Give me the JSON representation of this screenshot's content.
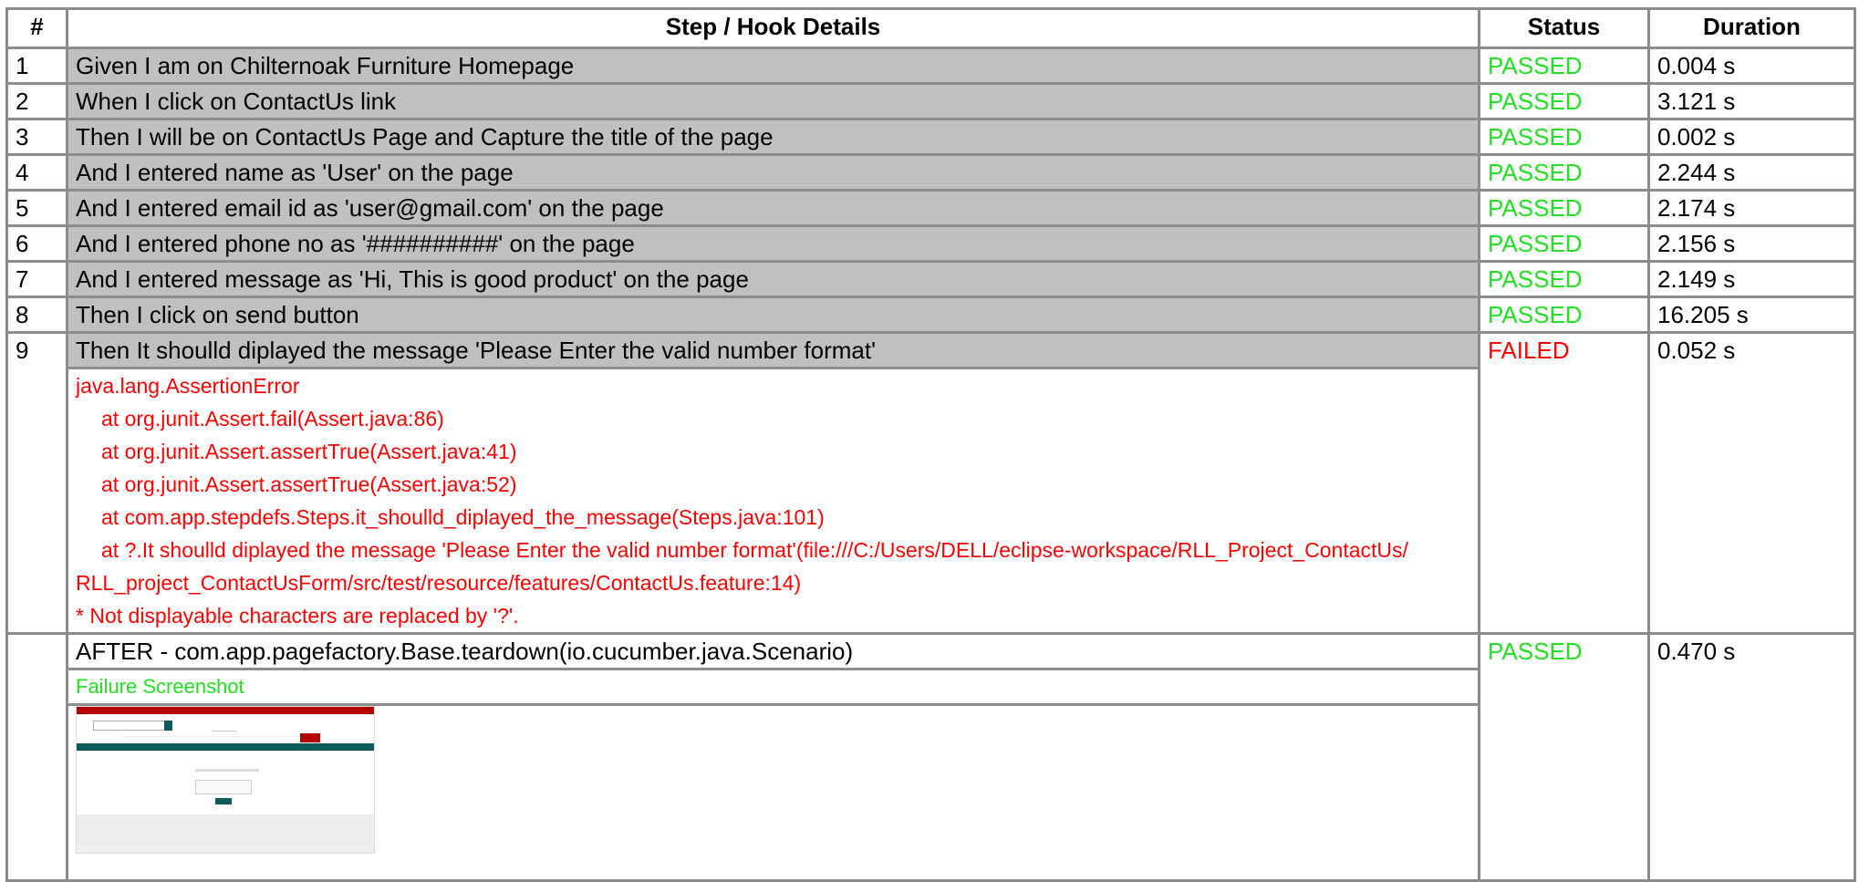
{
  "header": {
    "num": "#",
    "details": "Step / Hook Details",
    "status": "Status",
    "duration": "Duration"
  },
  "steps": [
    {
      "num": "1",
      "text": "Given I am on Chilternoak Furniture Homepage",
      "status": "PASSED",
      "duration": "0.004 s"
    },
    {
      "num": "2",
      "text": "When I click on ContactUs link",
      "status": "PASSED",
      "duration": "3.121 s"
    },
    {
      "num": "3",
      "text": "Then I will be on ContactUs Page and Capture the title of the page",
      "status": "PASSED",
      "duration": "0.002 s"
    },
    {
      "num": "4",
      "text": "And I entered name as 'User' on the page",
      "status": "PASSED",
      "duration": "2.244 s"
    },
    {
      "num": "5",
      "text": "And I entered email id as 'user@gmail.com' on the page",
      "status": "PASSED",
      "duration": "2.174 s"
    },
    {
      "num": "6",
      "text": "And I entered phone no as '##########' on the page",
      "status": "PASSED",
      "duration": "2.156 s"
    },
    {
      "num": "7",
      "text": "And I entered message as 'Hi, This is good product' on the page",
      "status": "PASSED",
      "duration": "2.149 s"
    },
    {
      "num": "8",
      "text": "Then I click on send button",
      "status": "PASSED",
      "duration": "16.205 s"
    },
    {
      "num": "9",
      "text": "Then It shoulld diplayed the message 'Please Enter the valid number format'",
      "status": "FAILED",
      "duration": "0.052 s"
    }
  ],
  "error": {
    "lines": [
      "java.lang.AssertionError",
      "at org.junit.Assert.fail(Assert.java:86)",
      "at org.junit.Assert.assertTrue(Assert.java:41)",
      "at org.junit.Assert.assertTrue(Assert.java:52)",
      "at com.app.stepdefs.Steps.it_shoulld_diplayed_the_message(Steps.java:101)",
      "at ?.It shoulld diplayed the message 'Please Enter the valid number format'(file:///C:/Users/DELL/eclipse-workspace/RLL_Project_ContactUs/",
      "RLL_project_ContactUsForm/src/test/resource/features/ContactUs.feature:14)",
      "* Not displayable characters are replaced by '?'."
    ]
  },
  "hook": {
    "text": "AFTER - com.app.pagefactory.Base.teardown(io.cucumber.java.Scenario)",
    "status": "PASSED",
    "duration": "0.470 s",
    "screenshot_label": "Failure Screenshot"
  },
  "colors": {
    "passed": "#22e022",
    "failed": "#ff0000",
    "step_bg": "#c0c0c0",
    "border": "#8c8c8c"
  }
}
